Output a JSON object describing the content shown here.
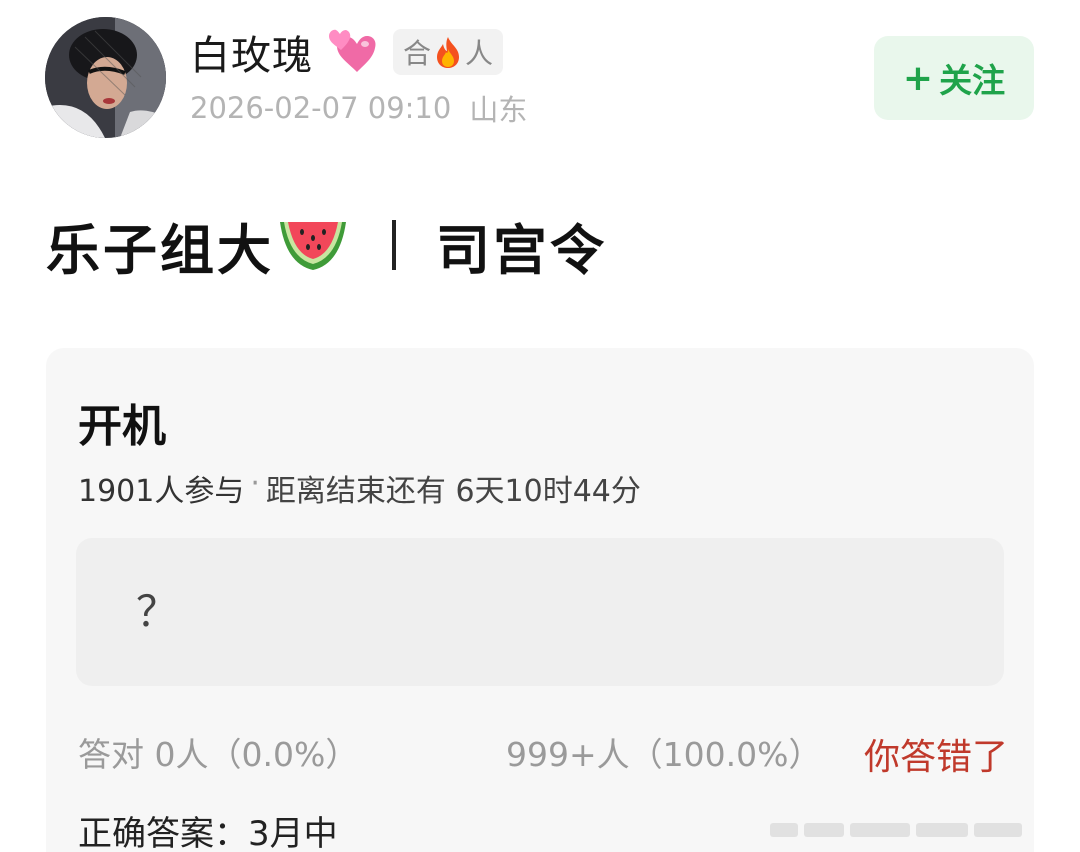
{
  "author": {
    "avatar_icon": "user-avatar-photo",
    "name": "白玫瑰",
    "name_emoji_icon": "two-hearts-icon",
    "badge": {
      "left": "合",
      "icon": "fire-icon",
      "right": "人"
    },
    "timestamp": "2026-02-07 09:10",
    "location": "山东"
  },
  "follow_button": {
    "plus": "+",
    "label": "关注",
    "bg_color": "#e9f7ec",
    "text_color": "#1fa34a"
  },
  "post": {
    "title_left": "乐子组大",
    "title_emoji_icon": "watermelon-icon",
    "title_right": "司宫令"
  },
  "quiz": {
    "title": "开机",
    "participants": "1901人参与",
    "separator": "·",
    "remaining": "距离结束还有 6天10时44分",
    "option_text": "？",
    "correct_stats": "答对  0人（0.0%）",
    "wrong_stats": "999+人（100.0%）",
    "result_label": "你答错了",
    "result_color": "#c0392b",
    "correct_answer": "正确答案：3月中"
  }
}
